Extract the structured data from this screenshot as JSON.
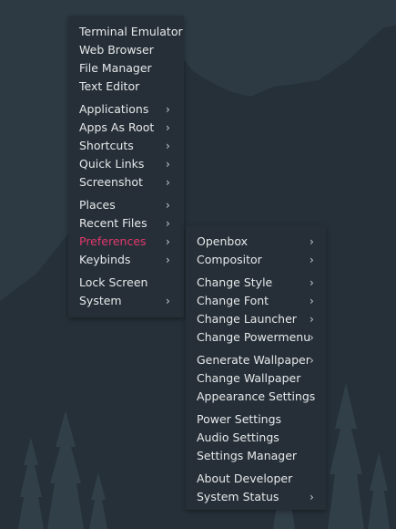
{
  "colors": {
    "sky": "#2e3a43",
    "mountain": "#252f36",
    "menu_bg": "#262f37",
    "menu_text": "#e6e9eb",
    "active_text": "#e2386e",
    "trees": "#34424c"
  },
  "root_menu": {
    "items": [
      {
        "label": "Terminal Emulator",
        "submenu": false
      },
      {
        "label": "Web Browser",
        "submenu": false
      },
      {
        "label": "File Manager",
        "submenu": false
      },
      {
        "label": "Text Editor",
        "submenu": false
      },
      {
        "label": "Applications",
        "submenu": true
      },
      {
        "label": "Apps As Root",
        "submenu": true
      },
      {
        "label": "Shortcuts",
        "submenu": true
      },
      {
        "label": "Quick Links",
        "submenu": true
      },
      {
        "label": "Screenshot",
        "submenu": true
      },
      {
        "label": "Places",
        "submenu": true
      },
      {
        "label": "Recent Files",
        "submenu": true
      },
      {
        "label": "Preferences",
        "submenu": true,
        "active": true
      },
      {
        "label": "Keybinds",
        "submenu": true
      },
      {
        "label": "Lock Screen",
        "submenu": false
      },
      {
        "label": "System",
        "submenu": true
      }
    ]
  },
  "preferences_menu": {
    "items": [
      {
        "label": "Openbox",
        "submenu": true
      },
      {
        "label": "Compositor",
        "submenu": true
      },
      {
        "label": "Change Style",
        "submenu": true
      },
      {
        "label": "Change Font",
        "submenu": true
      },
      {
        "label": "Change Launcher",
        "submenu": true
      },
      {
        "label": "Change Powermenu",
        "submenu": true
      },
      {
        "label": "Generate Wallpaper",
        "submenu": true
      },
      {
        "label": "Change Wallpaper",
        "submenu": false
      },
      {
        "label": "Appearance Settings",
        "submenu": false
      },
      {
        "label": "Power Settings",
        "submenu": false
      },
      {
        "label": "Audio Settings",
        "submenu": false
      },
      {
        "label": "Settings Manager",
        "submenu": false
      },
      {
        "label": "About Developer",
        "submenu": false
      },
      {
        "label": "System Status",
        "submenu": true
      }
    ]
  },
  "arrow_glyph": "›"
}
